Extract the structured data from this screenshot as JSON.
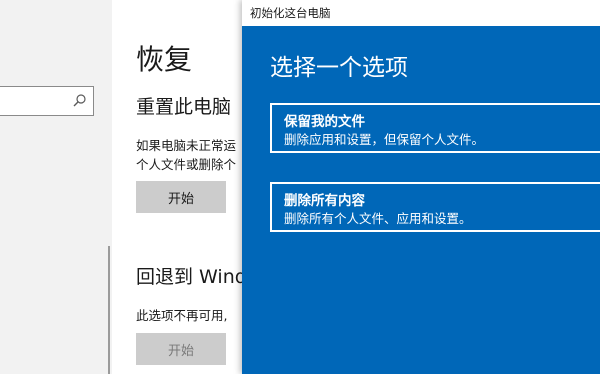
{
  "settings": {
    "search": {
      "placeholder": ""
    },
    "page_title": "恢复",
    "reset": {
      "title": "重置此电脑",
      "desc_line1": "如果电脑未正常运",
      "desc_line2": "个人文件或删除个",
      "button": "开始"
    },
    "goback": {
      "title": "回退到 Windows",
      "desc": "此选项不再可用,",
      "button": "开始"
    }
  },
  "dialog": {
    "window_title": "初始化这台电脑",
    "heading": "选择一个选项",
    "options": [
      {
        "title": "保留我的文件",
        "desc": "删除应用和设置，但保留个人文件。"
      },
      {
        "title": "删除所有内容",
        "desc": "删除所有个人文件、应用和设置。"
      }
    ]
  },
  "colors": {
    "dialog_bg": "#0067b8",
    "button_bg": "#cccccc",
    "left_bg": "#f2f2f2"
  },
  "icons": {
    "search": "search-icon"
  }
}
